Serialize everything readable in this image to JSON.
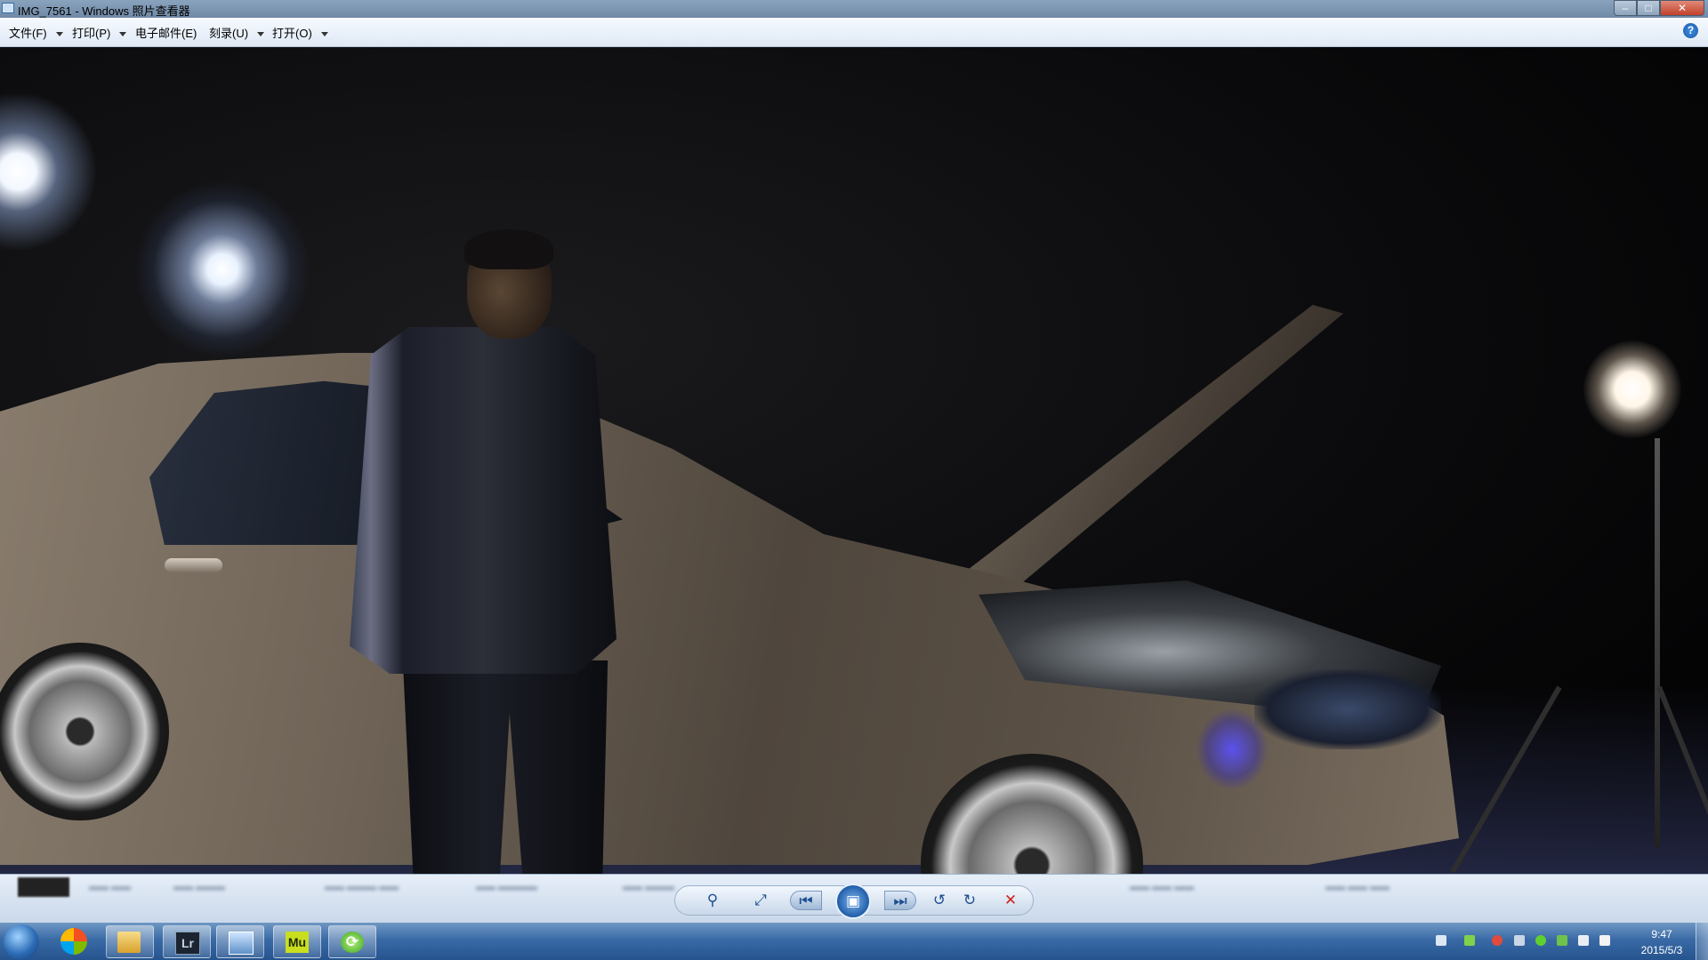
{
  "window": {
    "title": "IMG_7561 - Windows 照片查看器",
    "minimize": "–",
    "maximize": "□",
    "close": "✕"
  },
  "menu": {
    "items": [
      {
        "label": "文件(F)"
      },
      {
        "label": "打印(P)"
      },
      {
        "label": "电子邮件(E)"
      },
      {
        "label": "刻录(U)"
      },
      {
        "label": "打开(O)"
      }
    ],
    "help": "?"
  },
  "photo": {
    "subject": "person-standing-next-to-car-with-open-hood",
    "lights": [
      "studio-light-left",
      "studio-light-far-left",
      "studio-light-right"
    ]
  },
  "toolbar": {
    "zoom": "⚲",
    "fit": "⤢",
    "prev": "⏮",
    "slideshow": "▣",
    "next": "⏭",
    "rotate_left": "↺",
    "rotate_right": "↻",
    "delete": "✕"
  },
  "taskbar": {
    "apps": [
      {
        "name": "internet-explorer-icon"
      },
      {
        "name": "file-explorer-icon"
      },
      {
        "name": "lightroom-icon",
        "label": "Lr"
      },
      {
        "name": "photo-viewer-icon"
      },
      {
        "name": "muse-icon",
        "label": "Mu"
      },
      {
        "name": "green-refresh-icon"
      }
    ],
    "tray": {
      "icons": [
        "keyboard-icon",
        "battery-icon",
        "antivirus-icon",
        "network-share-icon",
        "green-plus-icon",
        "flag-icon",
        "network-icon",
        "volume-icon"
      ],
      "time": "9:47",
      "date": "2015/5/3"
    }
  },
  "colors": {
    "titlebar": "#7f98b4",
    "menubar": "#eaf1f9",
    "taskbar": "#3a6aa6",
    "delete": "#d1221b"
  }
}
